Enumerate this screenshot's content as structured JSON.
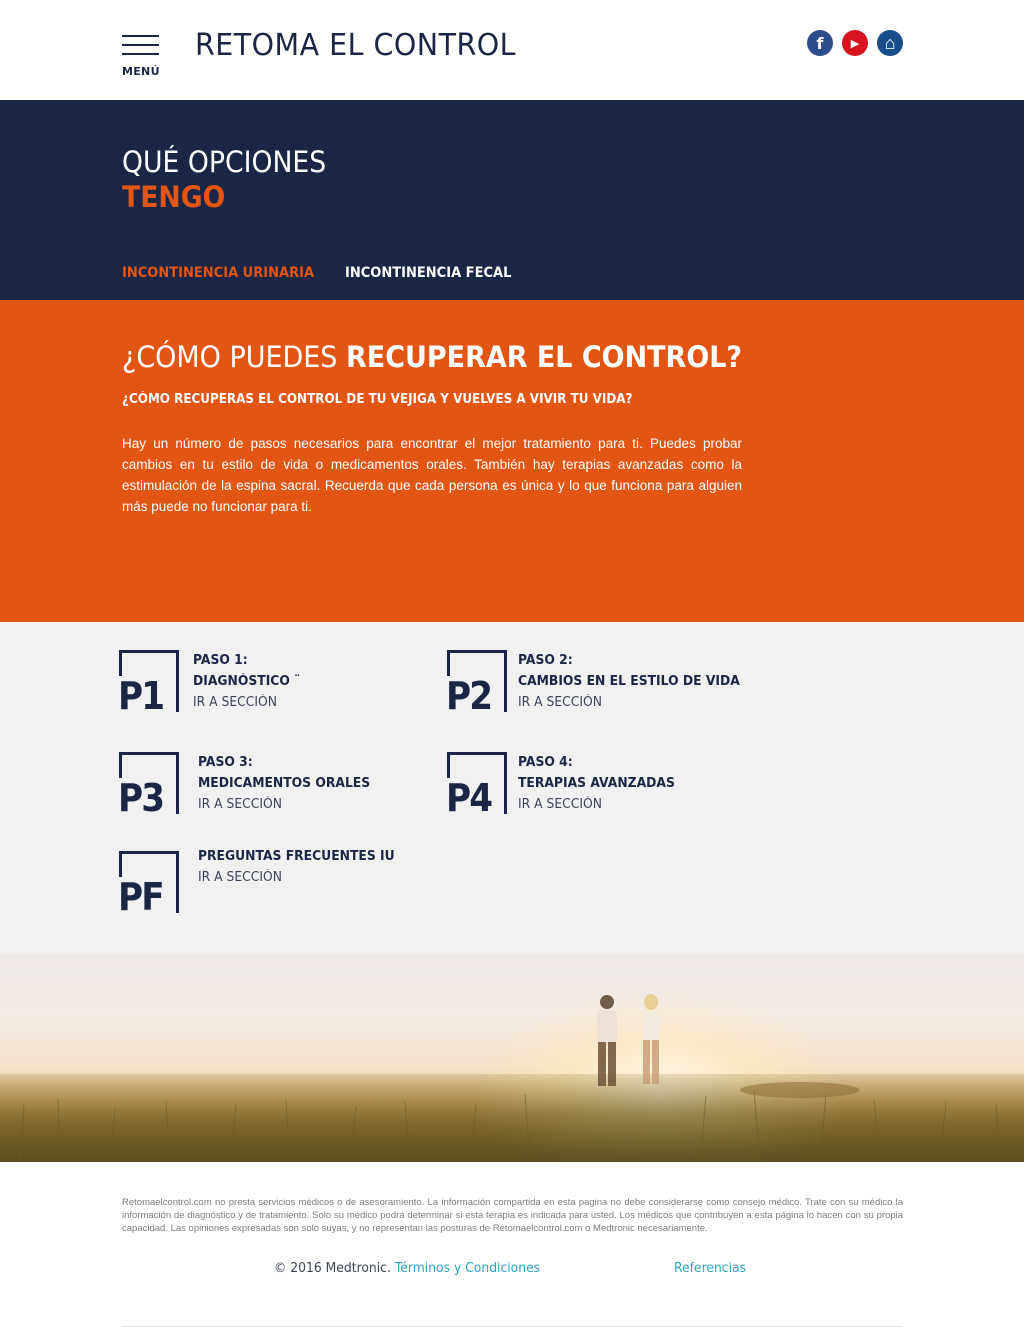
{
  "header": {
    "menu_label": "MENÚ",
    "site_title": "RETOMA EL CONTROL",
    "social": [
      {
        "name": "facebook",
        "glyph": "f",
        "color": "#2b4d8c"
      },
      {
        "name": "youtube",
        "glyph": "▶",
        "color": "#d6131f"
      },
      {
        "name": "home",
        "glyph": "⌂",
        "color": "#1a4d8c"
      }
    ]
  },
  "hero": {
    "title_light": "QUÉ OPCIONES",
    "title_bold": "TENGO",
    "tabs": [
      {
        "label": "INCONTINENCIA URINARIA",
        "active": true
      },
      {
        "label": "INCONTINENCIA FECAL",
        "active": false
      }
    ]
  },
  "section": {
    "heading_light": "¿CÓMO PUEDES ",
    "heading_bold": "RECUPERAR EL CONTROL?",
    "subheading": "¿CÓMO RECUPERAS EL CONTROL DE TU VEJIGA Y VUELVES A VIVIR TU VIDA?",
    "paragraph": "Hay un número de pasos necesarios para encontrar el mejor tratamiento para ti. Puedes probar cambios en tu estilo de vida o medicamentos orales. También hay terapias avanzadas como la estimulación de la espina sacral. Recuerda que cada persona es única y lo que funciona para alguien más puede no funcionar para ti."
  },
  "steps": [
    {
      "code": "P1",
      "step_label": "PASO 1:",
      "title": "DIAGNÓSTICO ¨",
      "link": "IR A SECCIÓN"
    },
    {
      "code": "P2",
      "step_label": "PASO 2:",
      "title": "CAMBIOS EN EL ESTILO DE VIDA",
      "link": "IR A SECCIÓN"
    },
    {
      "code": "P3",
      "step_label": "PASO 3:",
      "title": "MEDICAMENTOS ORALES",
      "link": "IR A SECCIÓN"
    },
    {
      "code": "P4",
      "step_label": "PASO 4:",
      "title": "TERAPIAS AVANZADAS",
      "link": "IR A SECCIÓN"
    },
    {
      "code": "PF",
      "step_label": "",
      "title": "PREGUNTAS FRECUENTES  IU",
      "link": "IR A SECCIÓN"
    }
  ],
  "footer": {
    "disclaimer": "Retomaelcontrol.com no presta servicios médicos o de asesoramiento. La información compartida en esta pagina no debe considerarse como consejo médico. Trate con su médico la información de diagnóstico y de tratamiento. Solo su médico podrá determinar si esta terapia es indicada para usted. Los médicos que contribuyen a esta página lo hacen con su propia capacidad. Las opiniones expresadas son solo suyas, y no representan las posturas de Retomaelcontrol.com o Medtronic necesariamente.",
    "copyright": "© 2016 Medtronic. ",
    "terms": "Términos y Condiciones",
    "references": "Referencias"
  },
  "colors": {
    "navy": "#1b2546",
    "orange": "#e35512",
    "grey": "#f1f1f1",
    "link": "#2aa3c9"
  }
}
